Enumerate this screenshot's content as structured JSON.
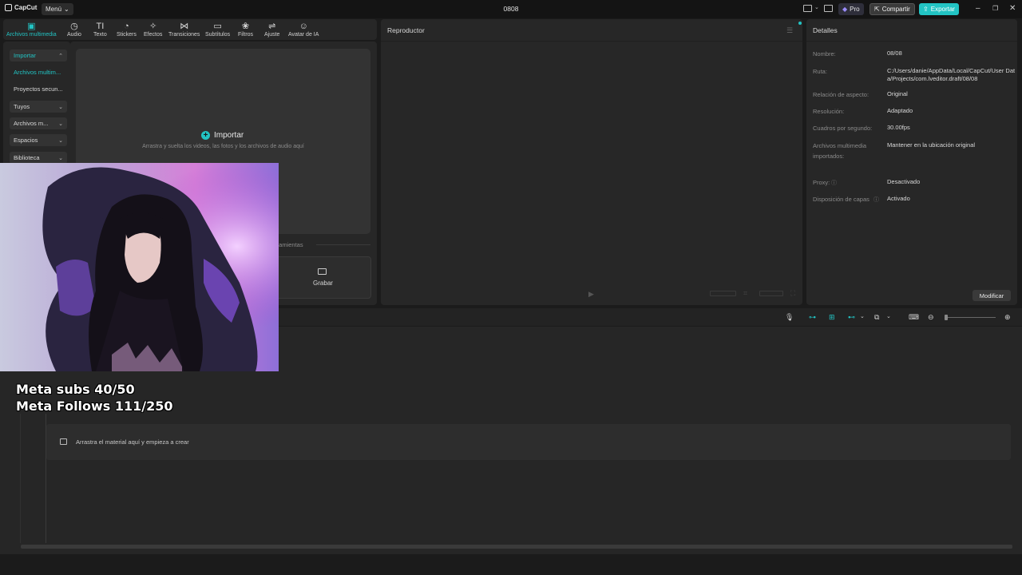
{
  "app": {
    "logo": "CapCut",
    "menu": "Menú",
    "title": "0808"
  },
  "topbar": {
    "pro": "Pro",
    "share": "Compartir",
    "export": "Exportar"
  },
  "tabs": [
    {
      "label": "Archivos multimedia",
      "icon": "media-icon"
    },
    {
      "label": "Audio",
      "icon": "audio-icon"
    },
    {
      "label": "Texto",
      "icon": "text-icon"
    },
    {
      "label": "Stickers",
      "icon": "stickers-icon"
    },
    {
      "label": "Efectos",
      "icon": "effects-icon"
    },
    {
      "label": "Transiciones",
      "icon": "transitions-icon"
    },
    {
      "label": "Subtítulos",
      "icon": "subtitles-icon"
    },
    {
      "label": "Filtros",
      "icon": "filters-icon"
    },
    {
      "label": "Ajuste",
      "icon": "adjust-icon"
    },
    {
      "label": "Avatar de IA",
      "icon": "ai-avatar-icon"
    }
  ],
  "sidebar": {
    "items": [
      {
        "label": "Importar"
      },
      {
        "label": "Archivos multim..."
      },
      {
        "label": "Proyectos secun..."
      },
      {
        "label": "Tuyos"
      },
      {
        "label": "Archivos m..."
      },
      {
        "label": "Espacios"
      },
      {
        "label": "Biblioteca"
      }
    ]
  },
  "media": {
    "import_label": "Importar",
    "import_hint": "Arrastra y suelta los videos, las fotos y los archivos de audio aquí",
    "tools_label": "erramientas",
    "record_label": "Grabar"
  },
  "player": {
    "title": "Reproductor"
  },
  "details": {
    "title": "Detalles",
    "rows": [
      {
        "label": "Nombre:",
        "value": "08/08"
      },
      {
        "label": "Ruta:",
        "value": "C:/Users/danie/AppData/Local/CapCut/User Data/Projects/com.lveditor.draft/08/08"
      },
      {
        "label": "Relación de aspecto:",
        "value": "Original"
      },
      {
        "label": "Resolución:",
        "value": "Adaptado"
      },
      {
        "label": "Cuadros por segundo:",
        "value": "30.00fps"
      },
      {
        "label": "Archivos multimedia importados:",
        "value": "Mantener en la ubicación original"
      },
      {
        "label": "Proxy:",
        "value": "Desactivado"
      },
      {
        "label": "Disposición de capas",
        "value": "Activado"
      }
    ],
    "modify": "Modificar"
  },
  "timeline": {
    "drop_hint": "Arrastra el material aquí y empieza a crear"
  },
  "overlay": {
    "line1": "Meta subs 40/50",
    "line2": "Meta Follows 111/250"
  },
  "colors": {
    "accent": "#22c4c4",
    "panel": "#272727",
    "background": "#1b1b1b"
  }
}
